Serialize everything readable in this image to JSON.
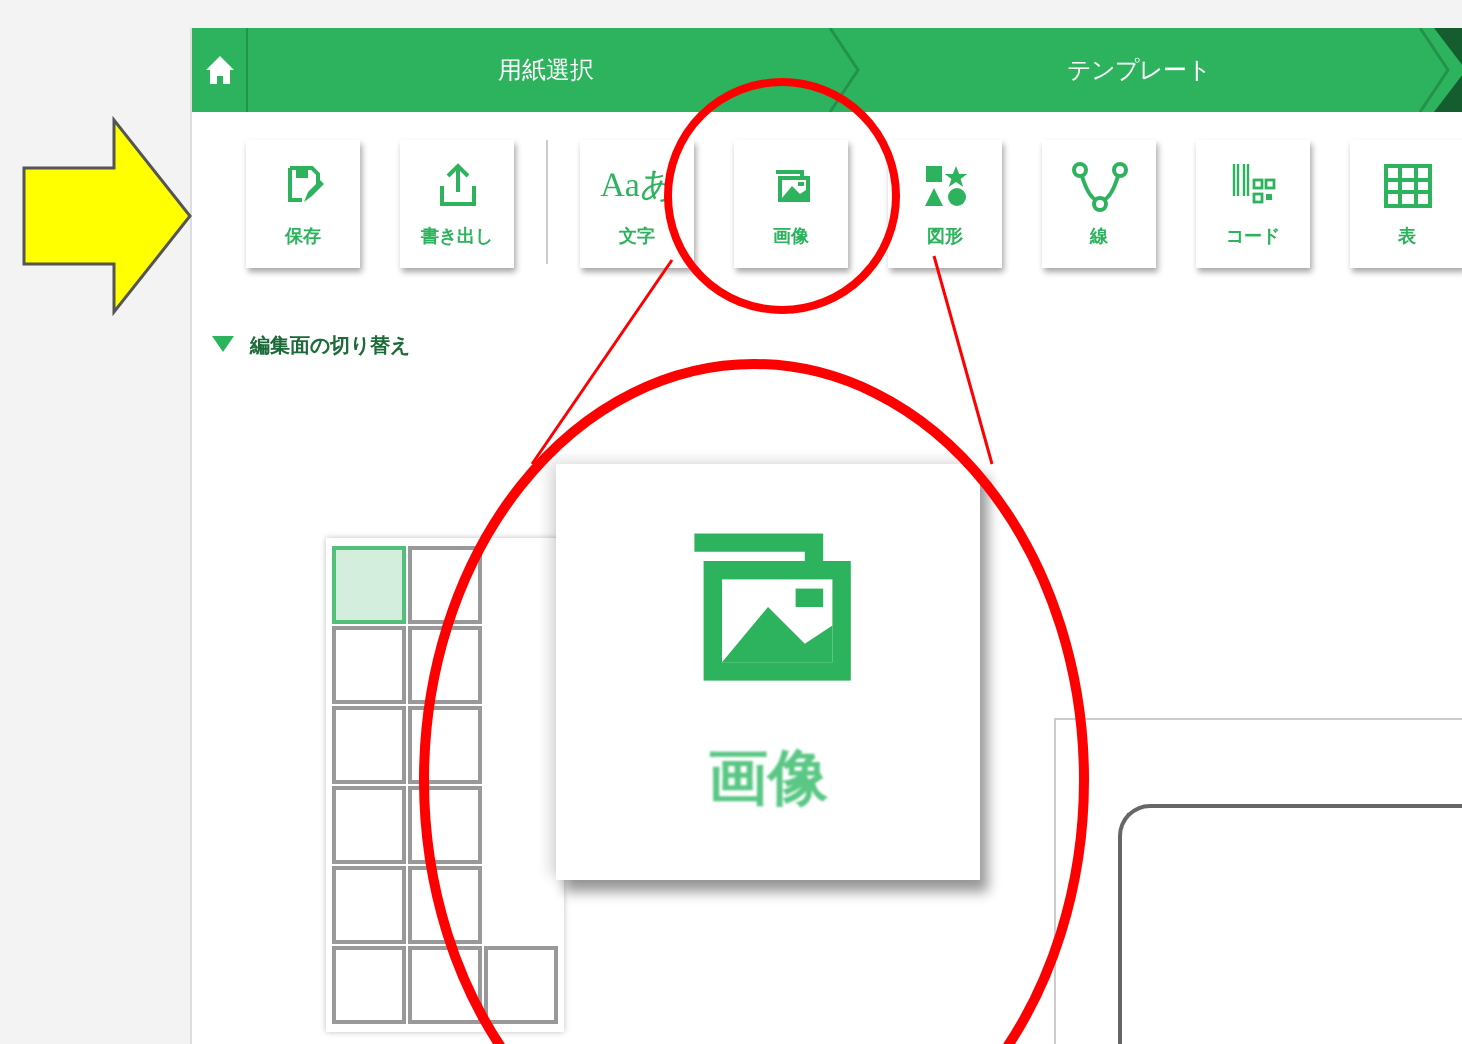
{
  "header": {
    "steps": [
      {
        "label": "用紙選択",
        "selected": false
      },
      {
        "label": "テンプレート",
        "selected": false
      },
      {
        "selected": true
      }
    ]
  },
  "toolbar": {
    "groups": [
      [
        {
          "kind": "save",
          "label": "保存"
        },
        {
          "kind": "export",
          "label": "書き出し"
        }
      ],
      [
        {
          "kind": "text",
          "label": "文字",
          "glyph": "Aaあ"
        },
        {
          "kind": "image",
          "label": "画像"
        },
        {
          "kind": "shape",
          "label": "図形"
        },
        {
          "kind": "line",
          "label": "線"
        },
        {
          "kind": "code",
          "label": "コード"
        },
        {
          "kind": "table",
          "label": "表"
        }
      ]
    ]
  },
  "section": {
    "label": "編集面の切り替え",
    "expanded": true
  },
  "page_grid": {
    "rows": [
      [
        {
          "selected": true
        },
        {
          "selected": false
        }
      ],
      [
        {
          "selected": false
        },
        {
          "selected": false
        }
      ],
      [
        {
          "selected": false
        },
        {
          "selected": false
        }
      ],
      [
        {
          "selected": false
        },
        {
          "selected": false
        }
      ],
      [
        {
          "selected": false
        },
        {
          "selected": false
        }
      ],
      [
        {
          "selected": false
        },
        {
          "selected": false
        },
        {
          "selected": false
        }
      ]
    ]
  },
  "zoom_callout": {
    "kind": "image",
    "label": "画像"
  }
}
